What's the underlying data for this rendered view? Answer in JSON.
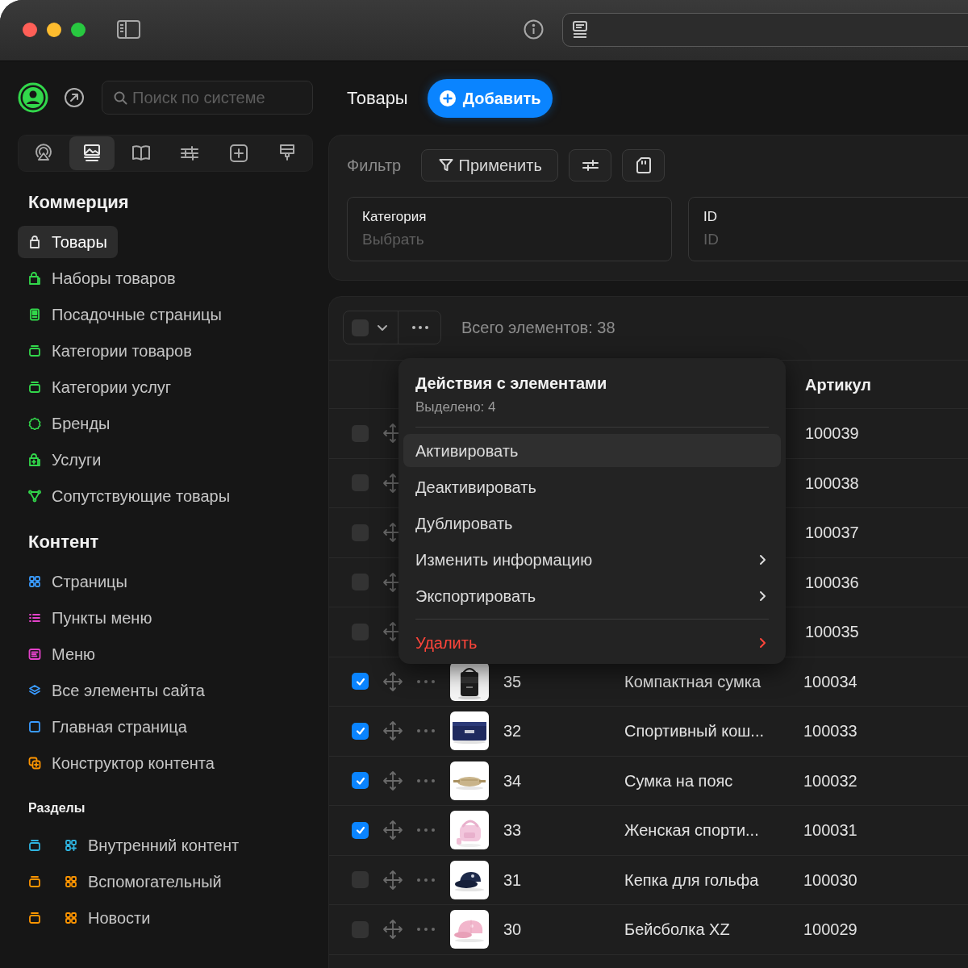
{
  "sidebar": {
    "search": {
      "placeholder": "Поиск по системе"
    },
    "tool_tabs": [
      {
        "selected": false
      },
      {
        "selected": true
      },
      {
        "selected": false
      },
      {
        "selected": false
      },
      {
        "selected": false
      },
      {
        "selected": false
      }
    ],
    "sections": [
      {
        "title": "Коммерция",
        "kind": "major",
        "items": [
          {
            "label": "Товары",
            "selected": true,
            "color": "#e0e0e0"
          },
          {
            "label": "Наборы товаров",
            "selected": false,
            "color": "#32d74b"
          },
          {
            "label": "Посадочные страницы",
            "selected": false,
            "color": "#32d74b"
          },
          {
            "label": "Категории товаров",
            "selected": false,
            "color": "#32d74b"
          },
          {
            "label": "Категории услуг",
            "selected": false,
            "color": "#32d74b"
          },
          {
            "label": "Бренды",
            "selected": false,
            "color": "#32d74b"
          },
          {
            "label": "Услуги",
            "selected": false,
            "color": "#32d74b"
          },
          {
            "label": "Сопутствующие товары",
            "selected": false,
            "color": "#32d74b"
          }
        ]
      },
      {
        "title": "Контент",
        "kind": "major",
        "items": [
          {
            "label": "Страницы",
            "selected": false,
            "color": "#3a9bff"
          },
          {
            "label": "Пункты меню",
            "selected": false,
            "color": "#e342c9"
          },
          {
            "label": "Меню",
            "selected": false,
            "color": "#e342c9"
          },
          {
            "label": "Все элементы сайта",
            "selected": false,
            "color": "#3a9bff"
          },
          {
            "label": "Главная страница",
            "selected": false,
            "color": "#3a9bff"
          },
          {
            "label": "Конструктор контента",
            "selected": false,
            "color": "#ff9500"
          }
        ]
      },
      {
        "title": "Разделы",
        "kind": "minor",
        "items": [
          {
            "label": "Внутренний контент",
            "selected": false,
            "color": "#2fb4e0"
          },
          {
            "label": "Вспомогательный",
            "selected": false,
            "color": "#ff9500"
          },
          {
            "label": "Новости",
            "selected": false,
            "color": "#ff9500"
          }
        ]
      }
    ]
  },
  "page": {
    "title": "Товары",
    "add_button": "Добавить"
  },
  "filter": {
    "label": "Фильтр",
    "apply_button": "Применить",
    "fields": [
      {
        "label": "Категория",
        "placeholder": "Выбрать"
      },
      {
        "label": "ID",
        "placeholder": "ID"
      }
    ]
  },
  "table": {
    "select_all": {
      "checked": false
    },
    "total": "Всего элементов: 38",
    "columns": [
      {
        "label": "Артикул"
      }
    ],
    "rows": [
      {
        "checked": false,
        "article": "100039"
      },
      {
        "checked": false,
        "article": "100038"
      },
      {
        "checked": false,
        "article": "100037"
      },
      {
        "checked": false,
        "article": "100036"
      },
      {
        "checked": false,
        "article": "100035"
      },
      {
        "checked": true,
        "id": "35",
        "name": "Компактная сумка",
        "article": "100034"
      },
      {
        "checked": true,
        "id": "32",
        "name": "Спортивный кош...",
        "article": "100033"
      },
      {
        "checked": true,
        "id": "34",
        "name": "Сумка на пояс",
        "article": "100032"
      },
      {
        "checked": true,
        "id": "33",
        "name": "Женская спорти...",
        "article": "100031"
      },
      {
        "checked": false,
        "id": "31",
        "name": "Кепка для гольфа",
        "article": "100030"
      },
      {
        "checked": false,
        "id": "30",
        "name": "Бейсболка XZ",
        "article": "100029"
      }
    ]
  },
  "menu": {
    "title": "Действия с элементами",
    "subtitle": "Выделено: 4",
    "items": [
      {
        "label": "Активировать",
        "kind": "normal",
        "selected": true,
        "submenu": false
      },
      {
        "label": "Деактивировать",
        "kind": "normal",
        "selected": false,
        "submenu": false
      },
      {
        "label": "Дублировать",
        "kind": "normal",
        "selected": false,
        "submenu": false
      },
      {
        "label": "Изменить информацию",
        "kind": "normal",
        "selected": false,
        "submenu": true
      },
      {
        "label": "Экспортировать",
        "kind": "normal",
        "selected": false,
        "submenu": true
      },
      {
        "label": "Удалить",
        "kind": "danger",
        "selected": false,
        "submenu": true
      }
    ]
  }
}
